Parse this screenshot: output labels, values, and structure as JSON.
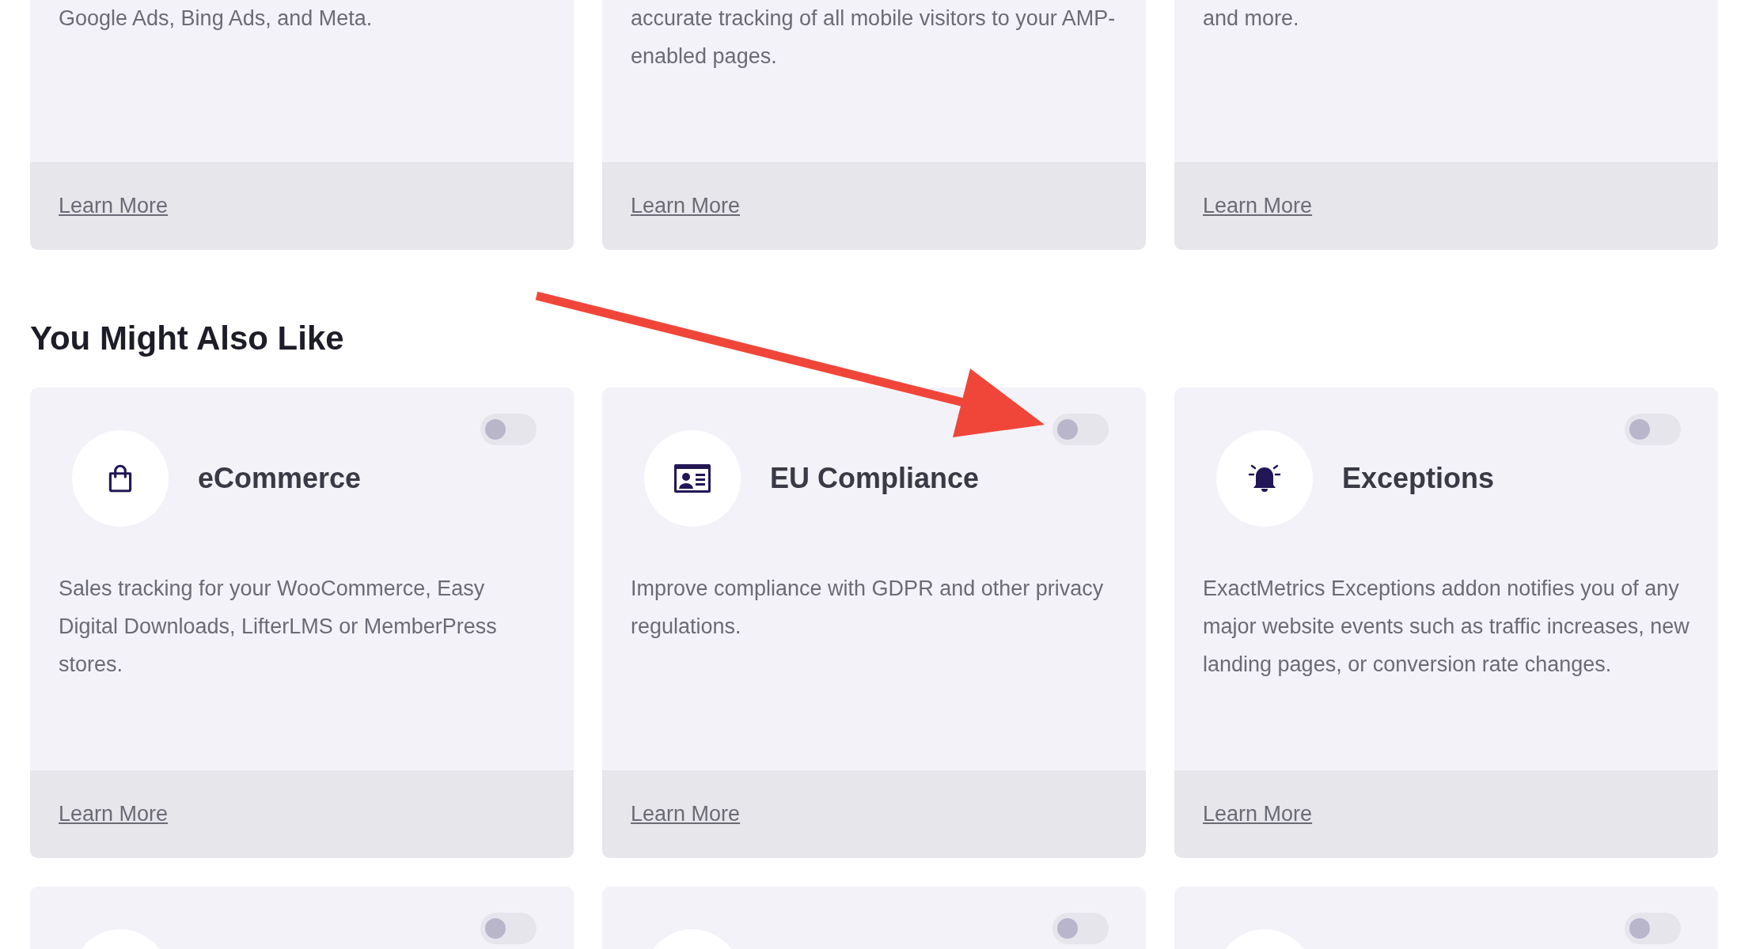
{
  "top_addons": [
    {
      "description": "Google Ads, Bing Ads, and Meta.",
      "link": "Learn More"
    },
    {
      "description": "accurate tracking of all mobile visitors to your AMP-enabled pages.",
      "link": "Learn More"
    },
    {
      "description": "and more.",
      "link": "Learn More"
    }
  ],
  "section_title": "You Might Also Like",
  "addons": [
    {
      "title": "eCommerce",
      "on": false,
      "description": "Sales tracking for your WooCommerce, Easy Digital Downloads, LifterLMS or MemberPress stores.",
      "link": "Learn More"
    },
    {
      "title": "EU Compliance",
      "on": false,
      "description": "Improve compliance with GDPR and other privacy regulations.",
      "link": "Learn More"
    },
    {
      "title": "Exceptions",
      "on": false,
      "description": "ExactMetrics Exceptions addon notifies you of any major website events such as traffic increases, new landing pages, or conversion rate changes.",
      "link": "Learn More"
    }
  ],
  "more_addons": [
    {
      "on": false
    },
    {
      "on": false
    },
    {
      "on": false
    }
  ]
}
